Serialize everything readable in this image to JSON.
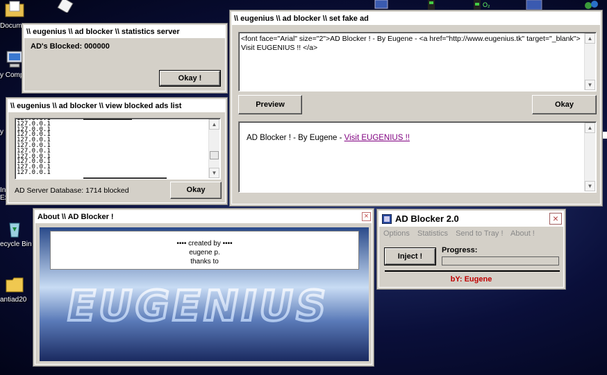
{
  "desktop": {
    "icons": [
      {
        "label": "Docum",
        "icon": "documents-folder-icon"
      },
      {
        "label": "y Comp",
        "icon": "my-computer-icon"
      },
      {
        "label": "y",
        "icon": "globe-icon"
      },
      {
        "label": "In",
        "icon": "internet-explorer-icon"
      },
      {
        "label": "ecycle Bin",
        "icon": "recycle-bin-icon"
      },
      {
        "label": "antiad20",
        "icon": "folder-icon"
      }
    ]
  },
  "stats_window": {
    "title": "\\\\ eugenius \\\\ ad blocker \\\\ statistics server",
    "blocked_label": "AD's Blocked:  000000",
    "okay": "Okay !"
  },
  "blocked_list_window": {
    "title": "\\\\ eugenius \\\\ ad blocker \\\\ view blocked ads list",
    "rows": [
      "127.0.0.1",
      "127.0.0.1",
      "127.0.0.1",
      "127.0.0.1",
      "127.0.0.1",
      "127.0.0.1",
      "127.0.0.1",
      "127.0.0.1",
      "127.0.0.1",
      "127.0.0.1",
      "127.0.0.1"
    ],
    "database_status": "AD Server Database: 1714 blocked",
    "okay": "Okay"
  },
  "fake_ad_window": {
    "title": "\\\\ eugenius \\\\ ad blocker \\\\ set fake ad",
    "html_code": "<font face=\"Arial\" size=\"2\">AD Blocker ! - By Eugene - <a href=\"http://www.eugenius.tk\" target=\"_blank\"> Visit  EUGENIUS !! </a>",
    "preview_button": "Preview",
    "okay_button": "Okay",
    "preview_text": "AD Blocker ! - By Eugene - ",
    "preview_link": "Visit EUGENIUS !!"
  },
  "about_window": {
    "title": "About \\\\ AD Blocker !",
    "credits_line1": "•••• created by ••••",
    "credits_line2": "eugene p.",
    "credits_line3": "thanks to",
    "banner": "EUGENIUS"
  },
  "main_window": {
    "title": "AD Blocker 2.0",
    "menu": [
      "Options",
      "Statistics",
      "Send to Tray !",
      "About !"
    ],
    "inject_button": "Inject !",
    "progress_label": "Progress:",
    "progress": 0,
    "footer": "bY: Eugene",
    "footer_color": "#c00000"
  }
}
